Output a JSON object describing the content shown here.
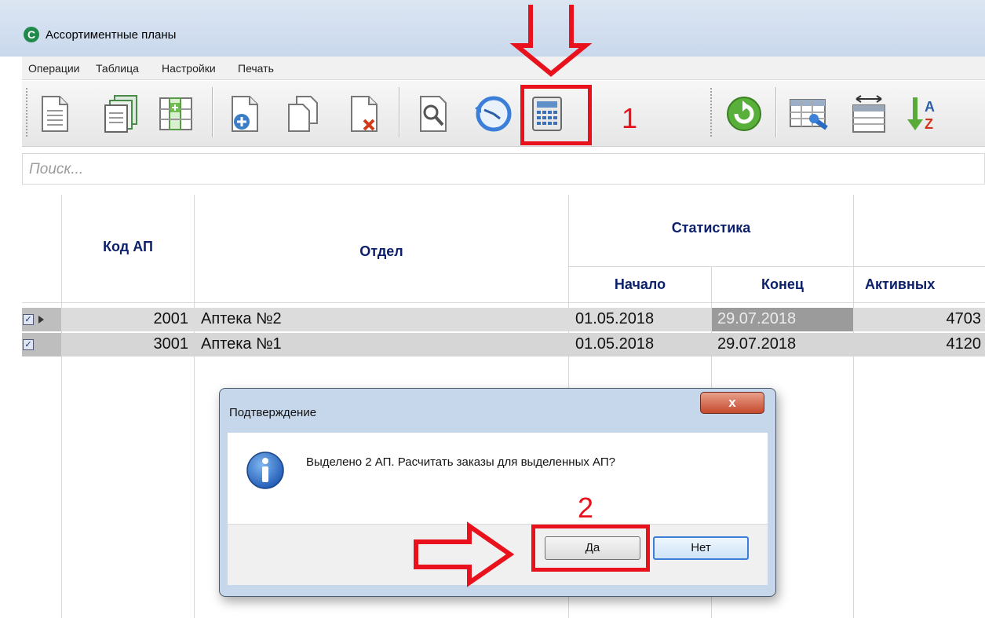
{
  "window": {
    "title": "Ассортиментные планы",
    "icon": "app-logo-icon"
  },
  "menu": {
    "items": [
      "Операции",
      "Таблица",
      "Настройки",
      "Печать"
    ]
  },
  "toolbar": {
    "buttons": [
      "new-document-icon",
      "copy-documents-icon",
      "add-column-icon",
      "add-file-icon",
      "duplicate-file-icon",
      "delete-file-icon",
      "search-document-icon",
      "history-icon",
      "calculator-icon",
      "refresh-icon",
      "table-settings-icon",
      "column-width-icon",
      "sort-az-icon"
    ]
  },
  "annotations": {
    "step1": "1",
    "step2": "2",
    "color": "#e8111c"
  },
  "search": {
    "placeholder": "Поиск..."
  },
  "table": {
    "headers": {
      "code": "Код АП",
      "department": "Отдел",
      "statistics": "Статистика",
      "start": "Начало",
      "end": "Конец",
      "active": "Активных"
    },
    "rows": [
      {
        "checked": true,
        "current": true,
        "code": "2001",
        "department": "Аптека №2",
        "start": "01.05.2018",
        "end": "29.07.2018",
        "active": "4703"
      },
      {
        "checked": true,
        "current": false,
        "code": "3001",
        "department": "Аптека №1",
        "start": "01.05.2018",
        "end": "29.07.2018",
        "active": "4120"
      }
    ]
  },
  "dialog": {
    "title": "Подтверждение",
    "close": "x",
    "message": "Выделено 2 АП. Расчитать заказы для выделенных АП?",
    "yes": "Да",
    "no": "Нет"
  },
  "colors": {
    "header_text": "#0b1f6b",
    "selection": "#bebebe",
    "dialog_frame": "#c6d7ec"
  }
}
